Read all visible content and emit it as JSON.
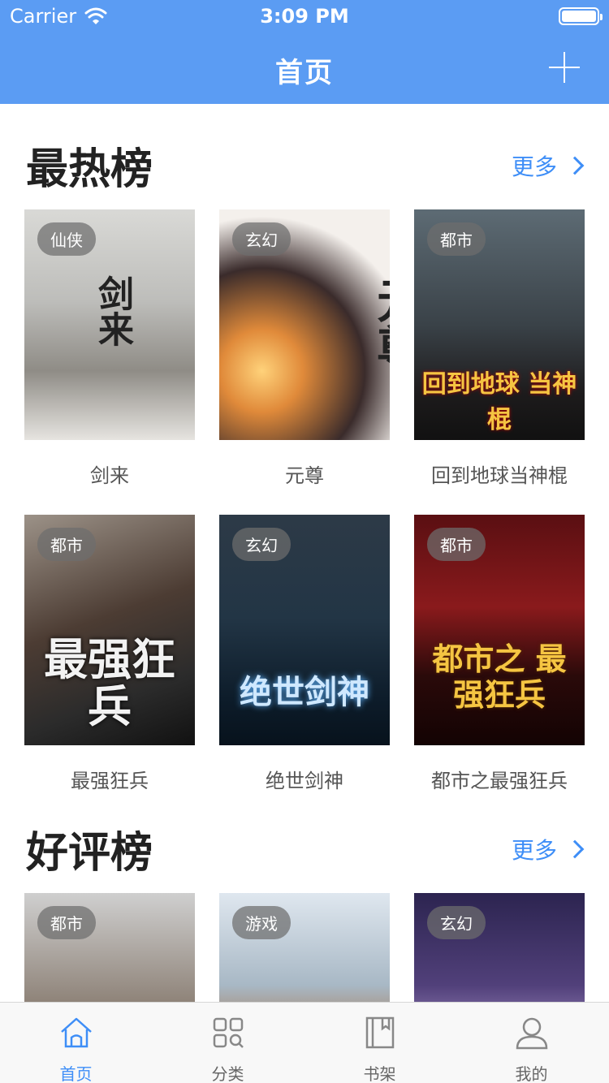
{
  "status": {
    "carrier": "Carrier",
    "time": "3:09 PM"
  },
  "nav": {
    "title": "首页"
  },
  "sections": [
    {
      "title": "最热榜",
      "more": "更多",
      "books": [
        {
          "title": "剑来",
          "tag": "仙侠",
          "cover_text": "剑来"
        },
        {
          "title": "元尊",
          "tag": "玄幻",
          "cover_text": "元尊"
        },
        {
          "title": "回到地球当神棍",
          "tag": "都市",
          "cover_text": "回到地球 当神棍"
        },
        {
          "title": "最强狂兵",
          "tag": "都市",
          "cover_text": "最强狂兵"
        },
        {
          "title": "绝世剑神",
          "tag": "玄幻",
          "cover_text": "绝世剑神"
        },
        {
          "title": "都市之最强狂兵",
          "tag": "都市",
          "cover_text": "都市之 最强狂兵"
        }
      ]
    },
    {
      "title": "好评榜",
      "more": "更多",
      "books": [
        {
          "tag": "都市"
        },
        {
          "tag": "游戏"
        },
        {
          "tag": "玄幻"
        }
      ]
    }
  ],
  "tabs": [
    {
      "label": "首页",
      "icon": "home-icon",
      "active": true
    },
    {
      "label": "分类",
      "icon": "category-icon",
      "active": false
    },
    {
      "label": "书架",
      "icon": "bookshelf-icon",
      "active": false
    },
    {
      "label": "我的",
      "icon": "profile-icon",
      "active": false
    }
  ],
  "colors": {
    "accent": "#3e8ef7",
    "nav_bg": "#5b9cf3"
  }
}
